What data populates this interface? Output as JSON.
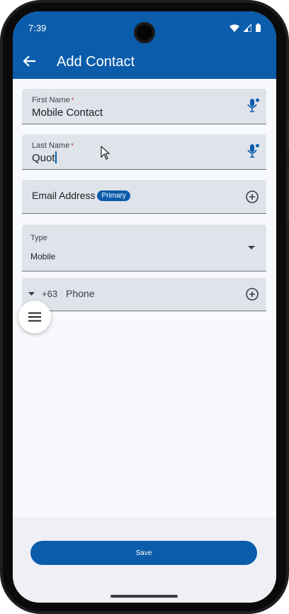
{
  "status_bar": {
    "time": "7:39"
  },
  "app_bar": {
    "title": "Add Contact"
  },
  "form": {
    "first_name": {
      "label": "First Name",
      "required_mark": "*",
      "value": "Mobile Contact"
    },
    "last_name": {
      "label": "Last Name",
      "required_mark": "*",
      "value": "Quot"
    },
    "email": {
      "label": "Email Address",
      "badge": "Primary"
    },
    "type": {
      "label": "Type",
      "value": "Mobile"
    },
    "phone": {
      "country_code": "+63",
      "label": "Phone"
    }
  },
  "footer": {
    "save_label": "Save"
  },
  "colors": {
    "primary": "#0b5cab",
    "field_bg": "#dfe3ea",
    "required": "#c62828"
  }
}
